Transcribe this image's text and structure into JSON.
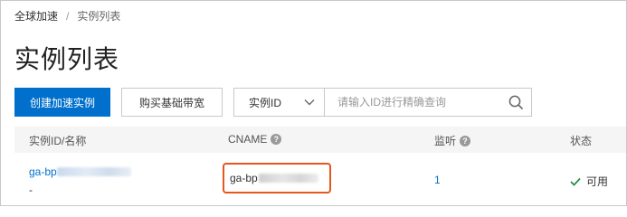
{
  "breadcrumb": {
    "root": "全球加速",
    "separator": "/",
    "current": "实例列表"
  },
  "page": {
    "title": "实例列表"
  },
  "toolbar": {
    "create_label": "创建加速实例",
    "buy_bandwidth_label": "购买基础带宽",
    "filter_select_value": "实例ID",
    "search_placeholder": "请输入ID进行精确查询"
  },
  "table": {
    "headers": {
      "instance": "实例ID/名称",
      "cname": "CNAME",
      "listeners": "监听",
      "status": "状态"
    },
    "rows": [
      {
        "instance_id": "ga-bp",
        "instance_name": "-",
        "cname": "ga-bp",
        "listeners": "1",
        "status": "可用"
      }
    ]
  },
  "colors": {
    "primary": "#0070cc",
    "highlight": "#e4571f",
    "success": "#1e8e3e"
  },
  "icons": {
    "help": "help-circle-icon",
    "search": "search-icon",
    "chevron": "chevron-down-icon",
    "status_ok": "check-icon"
  }
}
